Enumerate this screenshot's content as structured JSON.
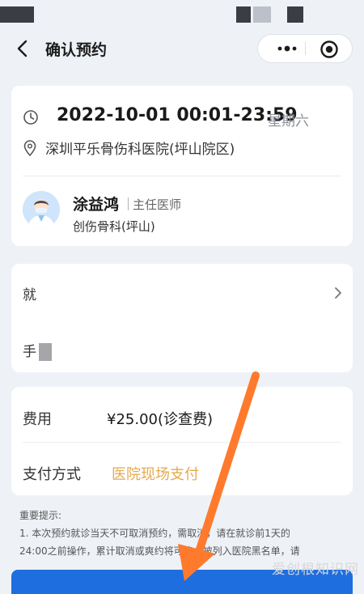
{
  "nav": {
    "title": "确认预约"
  },
  "appointment": {
    "datetime": "2022-10-01 00:01-23:59",
    "weekday": "星期六",
    "hospital": "深圳平乐骨伤科医院(坪山院区)",
    "doctor_name": "涂益鸿",
    "doctor_title": "主任医师",
    "department": "创伤骨科(坪山)"
  },
  "patient": {
    "row1_label": "就",
    "row2_label": "手"
  },
  "fee": {
    "fee_label": "费用",
    "fee_value": "¥25.00(诊查费)",
    "payment_label": "支付方式",
    "payment_value": "医院现场支付"
  },
  "notice": {
    "title": "重要提示:",
    "line1": "1. 本次预约就诊当天不可取消预约，需取消，请在就诊前1天的",
    "line2": "24:00之前操作，累计取消或爽约将可能会被列入医院黑名单，请"
  },
  "watermark": "爱创根知识网",
  "colors": {
    "primary": "#1f6ee0",
    "payment_accent": "#e7a94d",
    "arrow": "#ff7a2d",
    "background": "#eef2f7"
  }
}
